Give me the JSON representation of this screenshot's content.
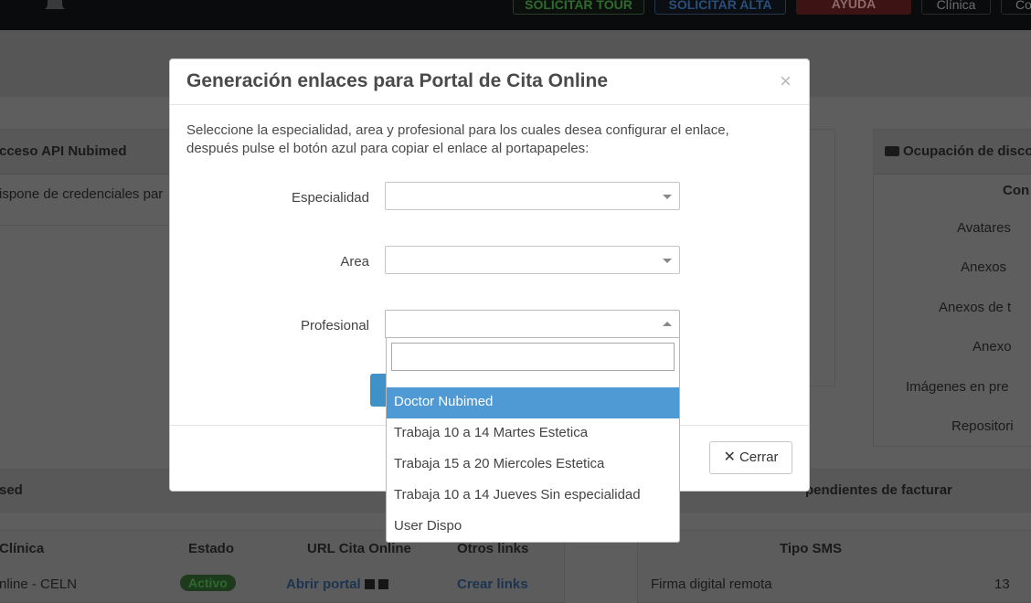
{
  "topbar": {
    "buttons": [
      "SOLICITAR TOUR",
      "SOLICITAR ALTA",
      "AYUDA",
      "Clínica",
      "Co"
    ]
  },
  "background": {
    "api_panel_title": "cceso API Nubimed",
    "api_panel_text": "ispone de credenciales par",
    "disk_panel_title": "Ocupación de disco",
    "disk_panel_col": "Con",
    "disk_items": [
      "Avatares",
      "Anexos",
      "Anexos de t",
      "Anexo",
      "Imágenes en pre",
      "Repositori"
    ],
    "section_left": "sed",
    "section_right": "pendientes de facturar",
    "table_headers": [
      "Clínica",
      "Estado",
      "URL Cita Online",
      "Otros links"
    ],
    "row": {
      "clinic": "nline - CELN",
      "estado": "Activo",
      "url": "Abrir portal",
      "links": "Crear links"
    },
    "sms_header": "Tipo SMS",
    "sms_row": {
      "tipo": "Firma digital remota",
      "count": "13"
    }
  },
  "modal": {
    "title": "Generación enlaces para Portal de Cita Online",
    "close": "×",
    "description": "Seleccione la especialidad, area y profesional para los cuales desea configurar el enlace, después pulse el botón azul para copiar el enlace al portapapeles:",
    "fields": {
      "especialidad": {
        "label": "Especialidad",
        "value": ""
      },
      "area": {
        "label": "Area",
        "value": ""
      },
      "profesional": {
        "label": "Profesional",
        "value": ""
      }
    },
    "close_button": "Cerrar"
  },
  "dropdown": {
    "search_value": "",
    "options": [
      "Doctor Nubimed",
      "Trabaja 10 a 14 Martes Estetica",
      "Trabaja 15 a 20 Miercoles Estetica",
      "Trabaja 10 a 14 Jueves Sin especialidad",
      "User Dispo"
    ],
    "highlighted_index": 0
  }
}
